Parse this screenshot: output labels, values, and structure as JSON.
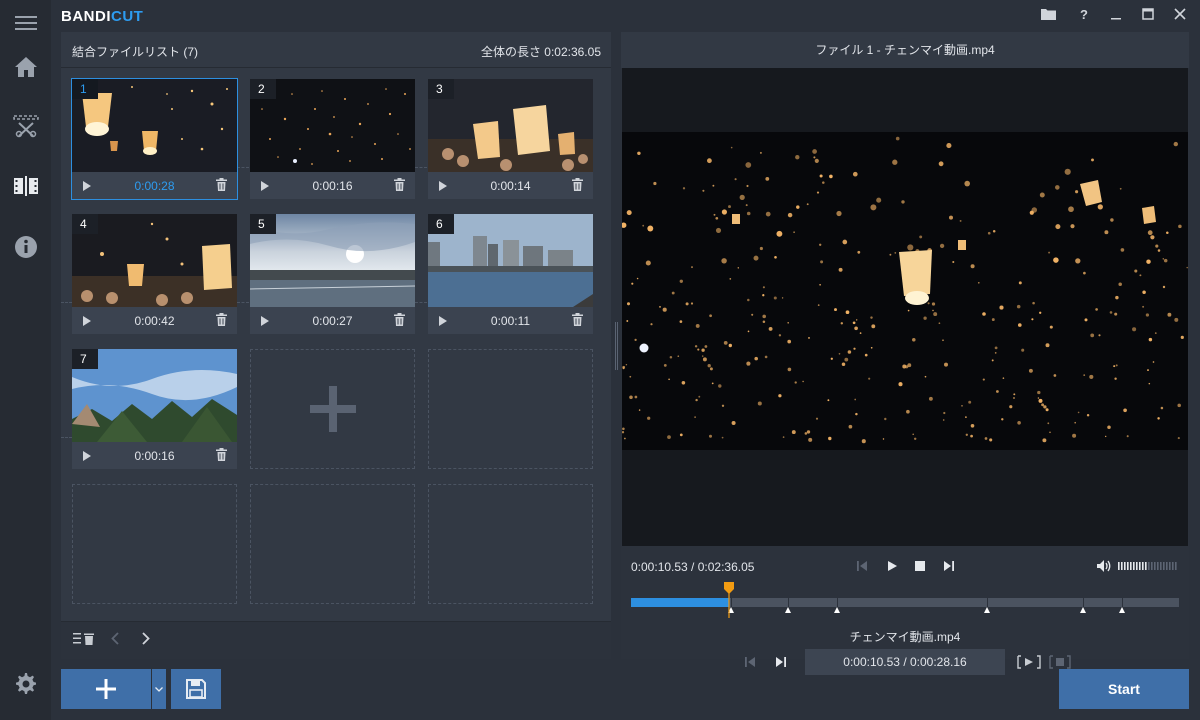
{
  "app": {
    "logo_main": "BANDI",
    "logo_accent": "CUT"
  },
  "file_list": {
    "title": "結合ファイルリスト (7)",
    "total_length": "全体の長さ 0:02:36.05",
    "items": [
      {
        "num": "1",
        "duration": "0:00:28",
        "selected": true,
        "scene": "lanterns-close"
      },
      {
        "num": "2",
        "duration": "0:00:16",
        "selected": false,
        "scene": "lanterns-sky"
      },
      {
        "num": "3",
        "duration": "0:00:14",
        "selected": false,
        "scene": "lanterns-crowd"
      },
      {
        "num": "4",
        "duration": "0:00:42",
        "selected": false,
        "scene": "lanterns-crowd-2"
      },
      {
        "num": "5",
        "duration": "0:00:27",
        "selected": false,
        "scene": "sunset-sea"
      },
      {
        "num": "6",
        "duration": "0:00:11",
        "selected": false,
        "scene": "city-waterfront"
      },
      {
        "num": "7",
        "duration": "0:00:16",
        "selected": false,
        "scene": "trees-sky"
      }
    ]
  },
  "player": {
    "title": "ファイル 1 - チェンマイ動画.mp4",
    "time_readout": "0:00:10.53 / 0:02:36.05",
    "progress_fraction": 0.1797,
    "clip_name": "チェンマイ動画.mp4",
    "clip_time": "0:00:10.53 / 0:00:28.16"
  },
  "buttons": {
    "start": "Start"
  },
  "colors": {
    "accent": "#2d8fe0",
    "button": "#3f6fa8",
    "playhead": "#f39c12"
  }
}
